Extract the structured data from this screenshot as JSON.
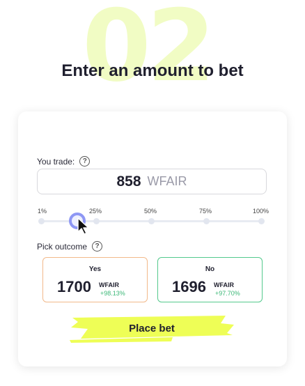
{
  "step": {
    "number": "02",
    "title": "Enter an amount to bet"
  },
  "trade": {
    "label": "You trade:",
    "help": "?",
    "amount": "858",
    "currency": "WFAIR"
  },
  "slider": {
    "ticks": [
      "1%",
      "25%",
      "50%",
      "75%",
      "100%"
    ],
    "level_percent": 15
  },
  "outcome_section": {
    "label": "Pick outcome",
    "help": "?"
  },
  "outcomes": [
    {
      "name": "Yes",
      "value": "1700",
      "currency": "WFAIR",
      "change": "+98.13%",
      "color": "#f2b98a"
    },
    {
      "name": "No",
      "value": "1696",
      "currency": "WFAIR",
      "change": "+97.70%",
      "color": "#53c98c"
    }
  ],
  "actions": {
    "place_bet": "Place bet"
  },
  "colors": {
    "highlight": "#eefe56",
    "slider_thumb": "#8e97f4",
    "positive": "#3cb878",
    "faded_number": "#f1fcc4"
  }
}
